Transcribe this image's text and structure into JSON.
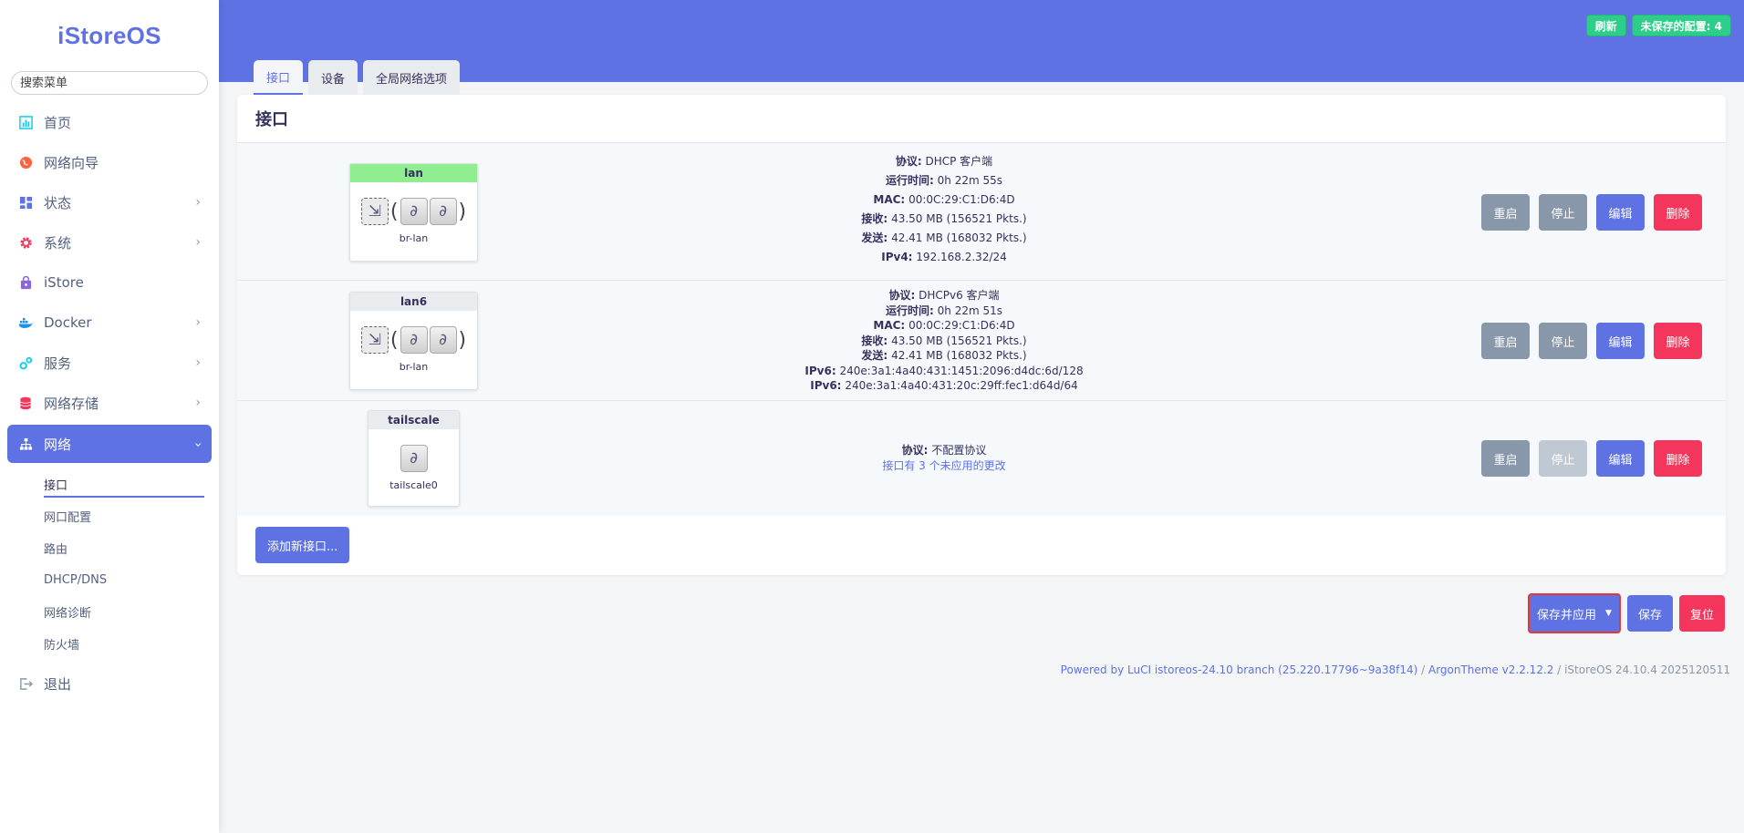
{
  "brand": "iStoreOS",
  "search": {
    "placeholder": "搜索菜单"
  },
  "sidebar": {
    "items": [
      {
        "label": "首页",
        "icon": "dashboard-icon"
      },
      {
        "label": "网络向导",
        "icon": "globe-icon"
      },
      {
        "label": "状态",
        "icon": "grid-icon"
      },
      {
        "label": "系统",
        "icon": "gear-icon"
      },
      {
        "label": "iStore",
        "icon": "store-bag-icon"
      },
      {
        "label": "Docker",
        "icon": "docker-icon"
      },
      {
        "label": "服务",
        "icon": "services-icon"
      },
      {
        "label": "网络存储",
        "icon": "database-icon"
      },
      {
        "label": "网络",
        "icon": "network-tree-icon"
      }
    ],
    "network_sub": [
      "接口",
      "网口配置",
      "路由",
      "DHCP/DNS",
      "网络诊断",
      "防火墙"
    ],
    "logout": "退出"
  },
  "header": {
    "refresh": "刷新",
    "unsaved": "未保存的配置: 4"
  },
  "tabs": [
    "接口",
    "设备",
    "全局网络选项"
  ],
  "panel_title": "接口",
  "interfaces": [
    {
      "name": "lan",
      "device": "br-lan",
      "lines": [
        {
          "k": "协议:",
          "v": "DHCP 客户端"
        },
        {
          "k": "运行时间:",
          "v": "0h 22m 55s"
        },
        {
          "k": "MAC:",
          "v": "00:0C:29:C1:D6:4D"
        },
        {
          "k": "接收:",
          "v": "43.50 MB (156521 Pkts.)"
        },
        {
          "k": "发送:",
          "v": "42.41 MB (168032 Pkts.)"
        },
        {
          "k": "IPv4:",
          "v": "192.168.2.32/24"
        }
      ]
    },
    {
      "name": "lan6",
      "device": "br-lan",
      "lines": [
        {
          "k": "协议:",
          "v": "DHCPv6 客户端"
        },
        {
          "k": "运行时间:",
          "v": "0h 22m 51s"
        },
        {
          "k": "MAC:",
          "v": "00:0C:29:C1:D6:4D"
        },
        {
          "k": "接收:",
          "v": "43.50 MB (156521 Pkts.)"
        },
        {
          "k": "发送:",
          "v": "42.41 MB (168032 Pkts.)"
        },
        {
          "k": "IPv6:",
          "v": "240e:3a1:4a40:431:1451:2096:d4dc:6d/128"
        },
        {
          "k": "IPv6:",
          "v": "240e:3a1:4a40:431:20c:29ff:fec1:d64d/64"
        }
      ]
    },
    {
      "name": "tailscale",
      "device": "tailscale0",
      "lines": [
        {
          "k": "协议:",
          "v": "不配置协议"
        }
      ],
      "notice": "接口有 3 个未应用的更改"
    }
  ],
  "row_buttons": {
    "restart": "重启",
    "stop": "停止",
    "edit": "编辑",
    "delete": "删除"
  },
  "add_button": "添加新接口...",
  "bottom": {
    "save_apply": "保存并应用",
    "save": "保存",
    "reset": "复位"
  },
  "footer": {
    "powered": "Powered by LuCI istoreos-24.10 branch (25.220.17796~9a38f14)",
    "theme": "ArgonTheme v2.2.12.2",
    "version": "iStoreOS 24.10.4 2025120511"
  },
  "colors": {
    "accent": "#5e72e4",
    "success": "#2dce89",
    "danger": "#f5365c",
    "muted": "#8898aa"
  }
}
